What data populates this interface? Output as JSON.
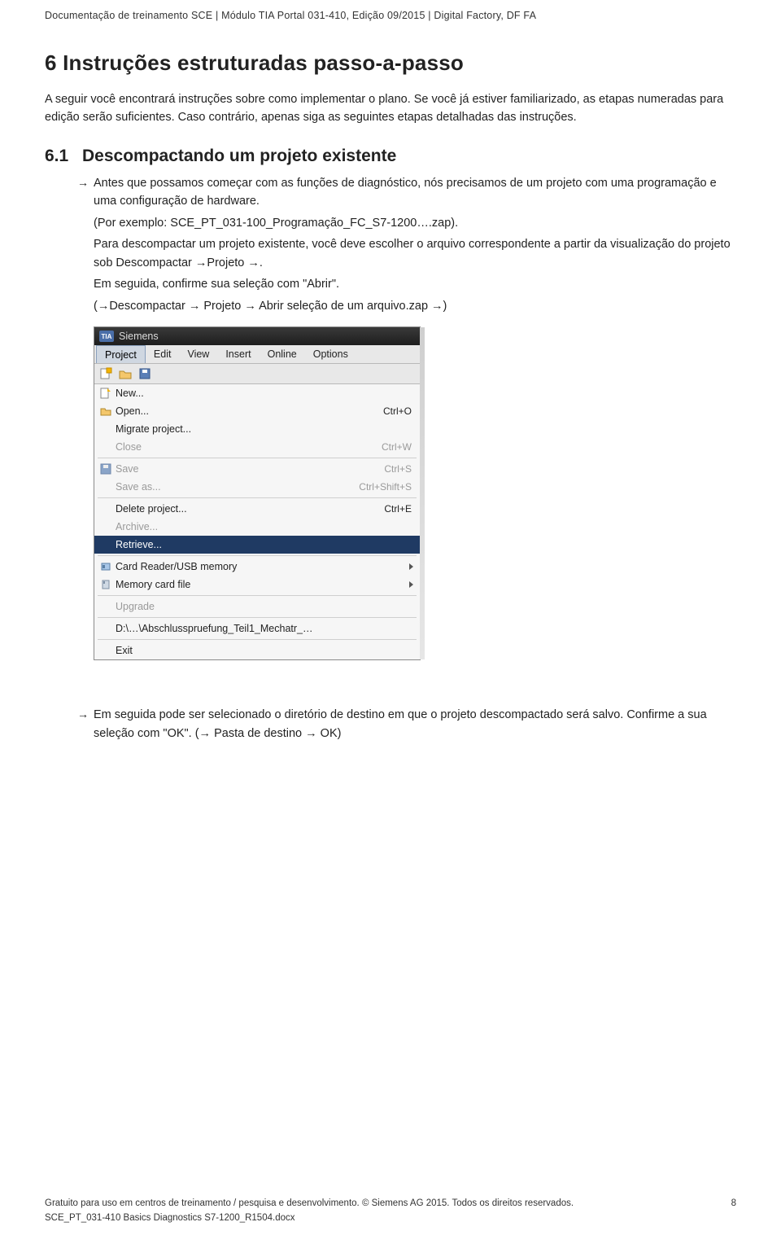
{
  "header": "Documentação de treinamento SCE | Módulo TIA Portal 031-410, Edição 09/2015 | Digital Factory, DF FA",
  "h1": "6   Instruções estruturadas passo-a-passo",
  "intro": "A seguir você encontrará instruções sobre como implementar o plano. Se você já estiver familiarizado, as etapas numeradas para edição serão suficientes. Caso contrário, apenas siga as seguintes etapas detalhadas das instruções.",
  "h2": {
    "num": "6.1",
    "text": "Descompactando um projeto existente"
  },
  "step1": {
    "p1": "Antes que possamos começar com as funções de diagnóstico, nós precisamos de um projeto com uma programação e uma configuração de hardware.",
    "p2": "(Por exemplo: SCE_PT_031-100_Programação_FC_S7-1200….zap).",
    "p3": "Para descompactar um projeto existente, você deve escolher o arquivo correspondente a partir da visualização do projeto sob Descompactar →Projeto →.",
    "p4": "Em seguida, confirme sua seleção com \"Abrir\".",
    "p5": "(→Descompactar → Projeto → Abrir seleção de um arquivo.zap →)"
  },
  "screenshot": {
    "title": "Siemens",
    "menubar": [
      "Project",
      "Edit",
      "View",
      "Insert",
      "Online",
      "Options"
    ],
    "toolbar_icons": [
      "arrow-left-icon",
      "arrow-right-icon",
      "save-icon"
    ],
    "items": [
      {
        "label": "New...",
        "shortcut": "",
        "icon": "new-icon",
        "state": "normal"
      },
      {
        "label": "Open...",
        "shortcut": "Ctrl+O",
        "icon": "open-icon",
        "state": "normal"
      },
      {
        "label": "Migrate project...",
        "shortcut": "",
        "icon": "",
        "state": "normal"
      },
      {
        "label": "Close",
        "shortcut": "Ctrl+W",
        "icon": "",
        "state": "disabled"
      },
      {
        "sep": true
      },
      {
        "label": "Save",
        "shortcut": "Ctrl+S",
        "icon": "save-icon",
        "state": "disabled"
      },
      {
        "label": "Save as...",
        "shortcut": "Ctrl+Shift+S",
        "icon": "",
        "state": "disabled"
      },
      {
        "sep": true
      },
      {
        "label": "Delete project...",
        "shortcut": "Ctrl+E",
        "icon": "",
        "state": "normal"
      },
      {
        "label": "Archive...",
        "shortcut": "",
        "icon": "",
        "state": "disabled"
      },
      {
        "label": "Retrieve...",
        "shortcut": "",
        "icon": "",
        "state": "selected"
      },
      {
        "sep": true
      },
      {
        "label": "Card Reader/USB memory",
        "shortcut": "",
        "icon": "card-icon",
        "state": "normal",
        "submenu": true
      },
      {
        "label": "Memory card file",
        "shortcut": "",
        "icon": "memcard-icon",
        "state": "normal",
        "submenu": true
      },
      {
        "sep": true
      },
      {
        "label": "Upgrade",
        "shortcut": "",
        "icon": "",
        "state": "disabled"
      },
      {
        "sep": true
      },
      {
        "label": "D:\\…\\Abschlusspruefung_Teil1_Mechatr_…",
        "shortcut": "",
        "icon": "",
        "state": "normal"
      },
      {
        "sep": true
      },
      {
        "label": "Exit",
        "shortcut": "",
        "icon": "",
        "state": "normal"
      }
    ]
  },
  "step2": {
    "p1": "Em seguida pode ser selecionado o diretório de destino em que o projeto descompactado será salvo. Confirme a sua seleção com \"OK\". (→ Pasta de destino → OK)"
  },
  "footer": {
    "left": "Gratuito para uso em centros de treinamento / pesquisa e desenvolvimento. © Siemens AG 2015. Todos os direitos reservados.",
    "page": "8",
    "doc": "SCE_PT_031-410 Basics Diagnostics S7-1200_R1504.docx"
  }
}
